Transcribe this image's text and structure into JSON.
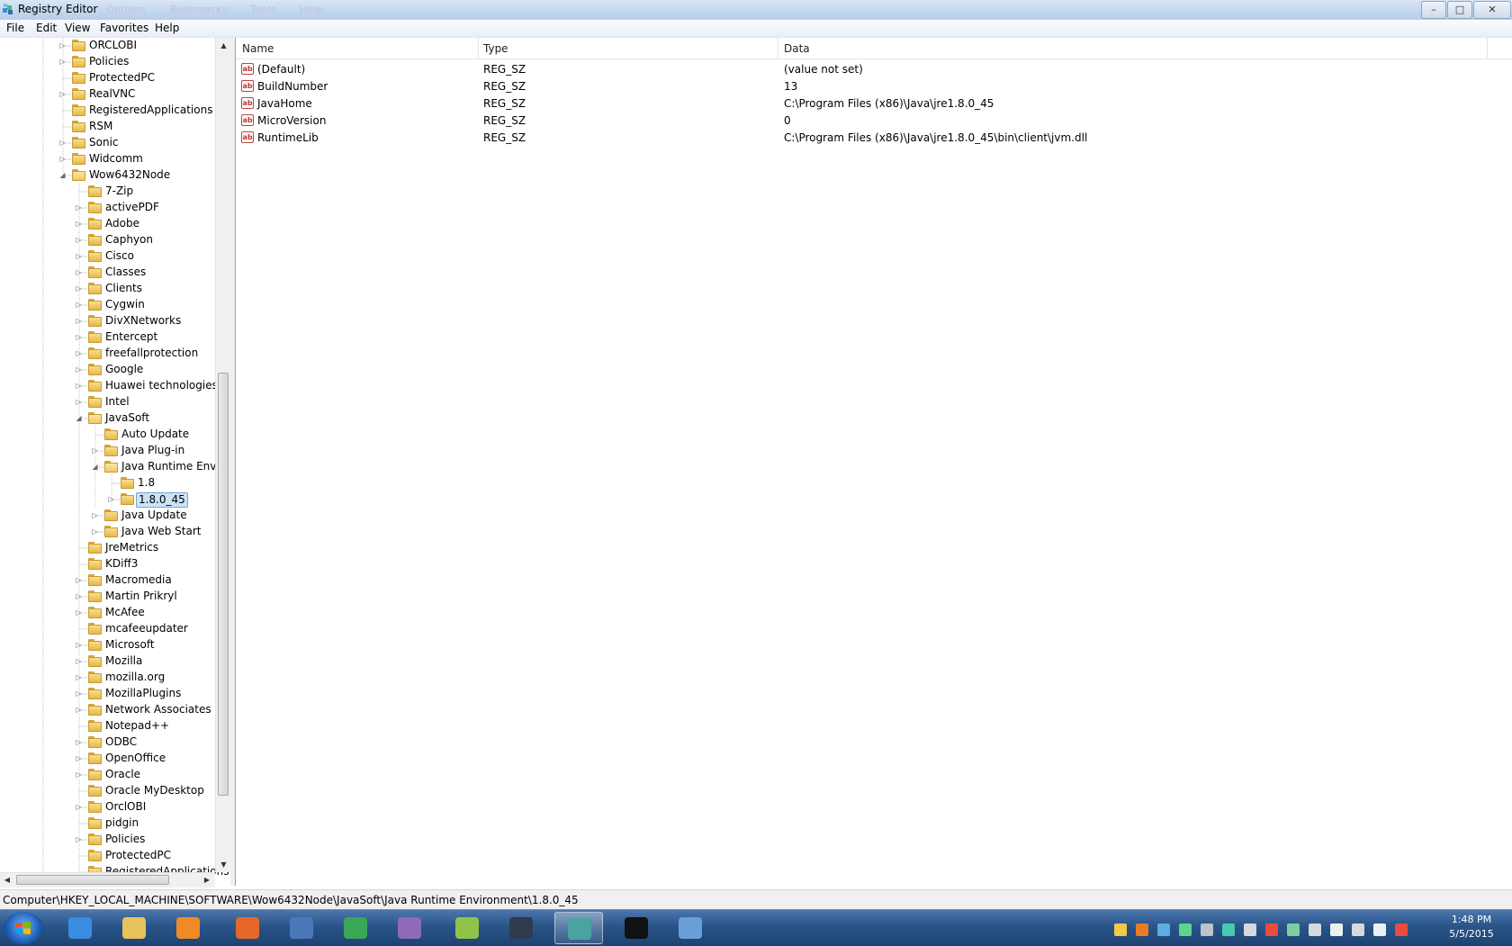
{
  "window": {
    "title": "Registry Editor",
    "ghost_menu": [
      "Options",
      "Bookmarks",
      "Tools",
      "Help"
    ],
    "buttons": {
      "minimize": "–",
      "maximize": "□",
      "close": "✕"
    }
  },
  "menu": [
    "File",
    "Edit",
    "View",
    "Favorites",
    "Help"
  ],
  "tree": {
    "rows": [
      {
        "label": "ORCLOBI",
        "level": 0,
        "expander": "collapsed"
      },
      {
        "label": "Policies",
        "level": 0,
        "expander": "collapsed"
      },
      {
        "label": "ProtectedPC",
        "level": 0,
        "expander": "none"
      },
      {
        "label": "RealVNC",
        "level": 0,
        "expander": "collapsed"
      },
      {
        "label": "RegisteredApplications",
        "level": 0,
        "expander": "none"
      },
      {
        "label": "RSM",
        "level": 0,
        "expander": "none"
      },
      {
        "label": "Sonic",
        "level": 0,
        "expander": "collapsed"
      },
      {
        "label": "Widcomm",
        "level": 0,
        "expander": "collapsed"
      },
      {
        "label": "Wow6432Node",
        "level": 0,
        "expander": "expanded"
      },
      {
        "label": "7-Zip",
        "level": 1,
        "expander": "none"
      },
      {
        "label": "activePDF",
        "level": 1,
        "expander": "collapsed"
      },
      {
        "label": "Adobe",
        "level": 1,
        "expander": "collapsed"
      },
      {
        "label": "Caphyon",
        "level": 1,
        "expander": "collapsed"
      },
      {
        "label": "Cisco",
        "level": 1,
        "expander": "collapsed"
      },
      {
        "label": "Classes",
        "level": 1,
        "expander": "collapsed"
      },
      {
        "label": "Clients",
        "level": 1,
        "expander": "collapsed"
      },
      {
        "label": "Cygwin",
        "level": 1,
        "expander": "collapsed"
      },
      {
        "label": "DivXNetworks",
        "level": 1,
        "expander": "collapsed"
      },
      {
        "label": "Entercept",
        "level": 1,
        "expander": "collapsed"
      },
      {
        "label": "freefallprotection",
        "level": 1,
        "expander": "collapsed"
      },
      {
        "label": "Google",
        "level": 1,
        "expander": "collapsed"
      },
      {
        "label": "Huawei technologies",
        "level": 1,
        "expander": "collapsed"
      },
      {
        "label": "Intel",
        "level": 1,
        "expander": "collapsed"
      },
      {
        "label": "JavaSoft",
        "level": 1,
        "expander": "expanded"
      },
      {
        "label": "Auto Update",
        "level": 2,
        "expander": "none"
      },
      {
        "label": "Java Plug-in",
        "level": 2,
        "expander": "collapsed"
      },
      {
        "label": "Java Runtime Envir",
        "level": 2,
        "expander": "expanded"
      },
      {
        "label": "1.8",
        "level": 3,
        "expander": "none"
      },
      {
        "label": "1.8.0_45",
        "level": 3,
        "expander": "collapsed",
        "selected": true
      },
      {
        "label": "Java Update",
        "level": 2,
        "expander": "collapsed"
      },
      {
        "label": "Java Web Start",
        "level": 2,
        "expander": "collapsed"
      },
      {
        "label": "JreMetrics",
        "level": 1,
        "expander": "none"
      },
      {
        "label": "KDiff3",
        "level": 1,
        "expander": "none"
      },
      {
        "label": "Macromedia",
        "level": 1,
        "expander": "collapsed"
      },
      {
        "label": "Martin Prikryl",
        "level": 1,
        "expander": "collapsed"
      },
      {
        "label": "McAfee",
        "level": 1,
        "expander": "collapsed"
      },
      {
        "label": "mcafeeupdater",
        "level": 1,
        "expander": "none"
      },
      {
        "label": "Microsoft",
        "level": 1,
        "expander": "collapsed"
      },
      {
        "label": "Mozilla",
        "level": 1,
        "expander": "collapsed"
      },
      {
        "label": "mozilla.org",
        "level": 1,
        "expander": "collapsed"
      },
      {
        "label": "MozillaPlugins",
        "level": 1,
        "expander": "collapsed"
      },
      {
        "label": "Network Associates",
        "level": 1,
        "expander": "collapsed"
      },
      {
        "label": "Notepad++",
        "level": 1,
        "expander": "none"
      },
      {
        "label": "ODBC",
        "level": 1,
        "expander": "collapsed"
      },
      {
        "label": "OpenOffice",
        "level": 1,
        "expander": "collapsed"
      },
      {
        "label": "Oracle",
        "level": 1,
        "expander": "collapsed"
      },
      {
        "label": "Oracle MyDesktop",
        "level": 1,
        "expander": "none"
      },
      {
        "label": "OrclOBI",
        "level": 1,
        "expander": "collapsed"
      },
      {
        "label": "pidgin",
        "level": 1,
        "expander": "none"
      },
      {
        "label": "Policies",
        "level": 1,
        "expander": "collapsed"
      },
      {
        "label": "ProtectedPC",
        "level": 1,
        "expander": "none"
      },
      {
        "label": "RegisteredApplications",
        "level": 1,
        "expander": "none"
      }
    ]
  },
  "list": {
    "columns": [
      "Name",
      "Type",
      "Data"
    ],
    "rows": [
      {
        "name": "(Default)",
        "type": "REG_SZ",
        "data": "(value not set)",
        "icon": "string-value-icon"
      },
      {
        "name": "BuildNumber",
        "type": "REG_SZ",
        "data": "13",
        "icon": "string-value-icon"
      },
      {
        "name": "JavaHome",
        "type": "REG_SZ",
        "data": "C:\\Program Files (x86)\\Java\\jre1.8.0_45",
        "icon": "string-value-icon"
      },
      {
        "name": "MicroVersion",
        "type": "REG_SZ",
        "data": "0",
        "icon": "string-value-icon"
      },
      {
        "name": "RuntimeLib",
        "type": "REG_SZ",
        "data": "C:\\Program Files (x86)\\Java\\jre1.8.0_45\\bin\\client\\jvm.dll",
        "icon": "string-value-icon"
      }
    ]
  },
  "status": "Computer\\HKEY_LOCAL_MACHINE\\SOFTWARE\\Wow6432Node\\JavaSoft\\Java Runtime Environment\\1.8.0_45",
  "taskbar": {
    "apps": [
      {
        "name": "internet-explorer",
        "color": "#3b8be0"
      },
      {
        "name": "file-explorer",
        "color": "#e8c25a"
      },
      {
        "name": "media-player",
        "color": "#f08a24"
      },
      {
        "name": "firefox",
        "color": "#e6672a"
      },
      {
        "name": "thunderbird",
        "color": "#4a78b8"
      },
      {
        "name": "chrome",
        "color": "#3aa757"
      },
      {
        "name": "pidgin",
        "color": "#8e6ab8"
      },
      {
        "name": "notepad-plus-plus",
        "color": "#8fc449"
      },
      {
        "name": "eclipse",
        "color": "#2f3b4d"
      },
      {
        "name": "registry-editor",
        "color": "#4aa3a0",
        "active": true
      },
      {
        "name": "command-prompt",
        "color": "#111111"
      },
      {
        "name": "remote-desktop",
        "color": "#6a9fd8"
      }
    ],
    "clock_time": "1:48 PM",
    "clock_date": "5/5/2015"
  },
  "colors": {
    "selection_bg": "#cce4f7",
    "selection_border": "#7da2ce",
    "taskbar": "#2a5489",
    "folder": "#e6b84a"
  }
}
